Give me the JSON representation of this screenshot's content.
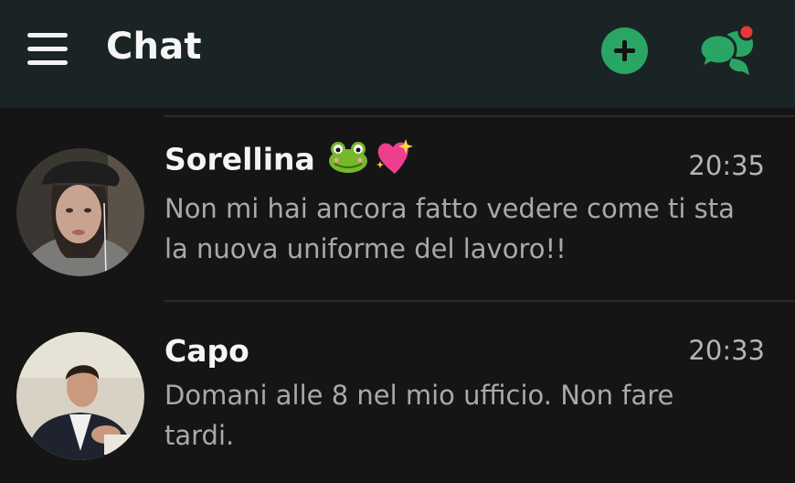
{
  "header": {
    "title": "Chat",
    "menu_icon": "hamburger-menu-icon",
    "new_chat_icon": "plus-circle-icon",
    "chats_icon": "chat-bubbles-icon",
    "notification_dot": true,
    "accent_color": "#2aa664",
    "notification_color": "#e53935"
  },
  "chats": [
    {
      "name": "Sorellina",
      "name_emojis": [
        "frog-emoji",
        "sparkling-heart-emoji"
      ],
      "time": "20:35",
      "preview": "Non mi hai ancora fatto vedere come ti sta la nuova uniforme del lavoro!!",
      "avatar": "avatar-sorellina"
    },
    {
      "name": "Capo",
      "name_emojis": [],
      "time": "20:33",
      "preview": "Domani alle 8 nel mio ufficio. Non fare tardi.",
      "avatar": "avatar-capo"
    }
  ]
}
